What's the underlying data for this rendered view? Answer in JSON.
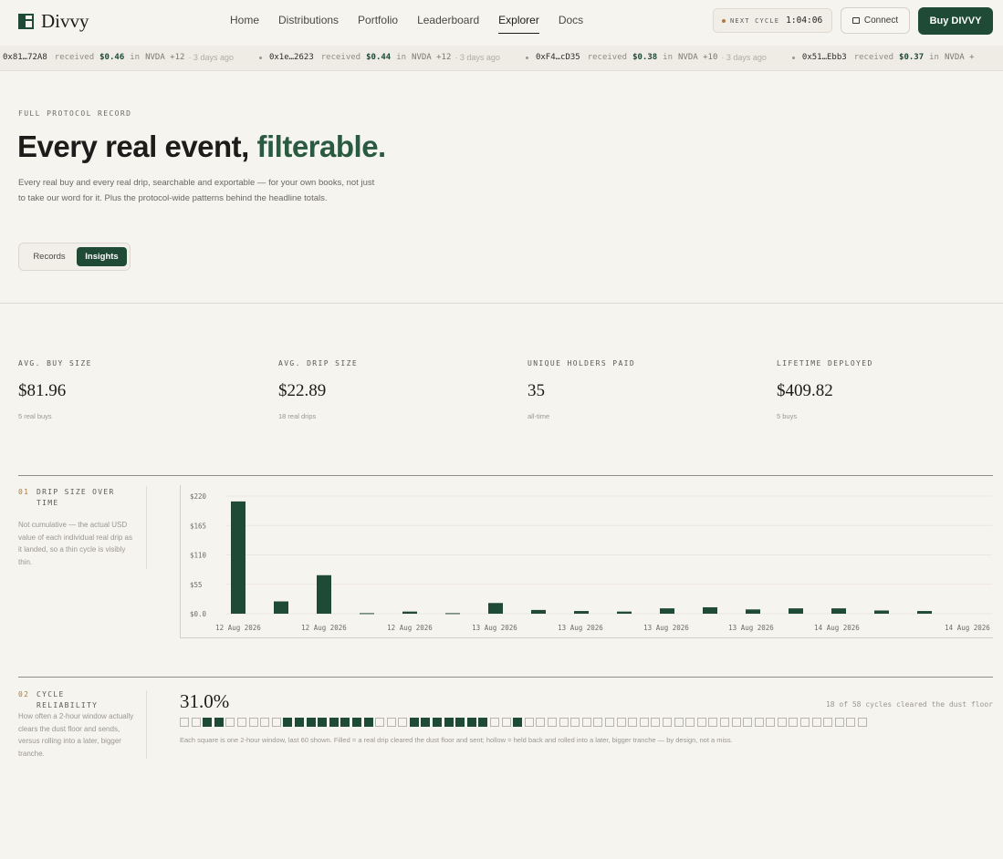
{
  "brand": {
    "name": "Divvy"
  },
  "nav": [
    {
      "label": "Home",
      "active": false
    },
    {
      "label": "Distributions",
      "active": false
    },
    {
      "label": "Portfolio",
      "active": false
    },
    {
      "label": "Leaderboard",
      "active": false
    },
    {
      "label": "Explorer",
      "active": true
    },
    {
      "label": "Docs",
      "active": false
    }
  ],
  "cycle": {
    "label": "NEXT CYCLE",
    "time": "1:04:06"
  },
  "header": {
    "connect_label": "Connect",
    "buy_label": "Buy DIVVY"
  },
  "ticker": [
    {
      "addr": "0x81…72A8",
      "verb": "received",
      "amount": "$0.46",
      "in": "in",
      "asset": "NVDA +12",
      "ago": "· 3 days ago"
    },
    {
      "addr": "0x1e…2623",
      "verb": "received",
      "amount": "$0.44",
      "in": "in",
      "asset": "NVDA +12",
      "ago": "· 3 days ago"
    },
    {
      "addr": "0xF4…cD35",
      "verb": "received",
      "amount": "$0.38",
      "in": "in",
      "asset": "NVDA +10",
      "ago": "· 3 days ago"
    },
    {
      "addr": "0x51…Ebb3",
      "verb": "received",
      "amount": "$0.37",
      "in": "in",
      "asset": "NVDA +",
      "ago": ""
    }
  ],
  "hero": {
    "eyebrow": "FULL PROTOCOL RECORD",
    "title_main": "Every real event, ",
    "title_accent": "filterable.",
    "description": "Every real buy and every real drip, searchable and exportable — for your own books, not just to take our word for it. Plus the protocol-wide patterns behind the headline totals."
  },
  "tabs": {
    "records": "Records",
    "insights": "Insights",
    "active": "Insights"
  },
  "stats": [
    {
      "label": "AVG. BUY SIZE",
      "value": "$81.96",
      "sub": "5 real buys"
    },
    {
      "label": "AVG. DRIP SIZE",
      "value": "$22.89",
      "sub": "18 real drips"
    },
    {
      "label": "UNIQUE HOLDERS PAID",
      "value": "35",
      "sub": "all-time"
    },
    {
      "label": "LIFETIME DEPLOYED",
      "value": "$409.82",
      "sub": "5 buys"
    }
  ],
  "drip_section": {
    "num": "01",
    "title": "DRIP SIZE OVER TIME",
    "desc": "Not cumulative — the actual USD value of each individual real drip as it landed, so a thin cycle is visibly thin."
  },
  "chart_data": {
    "type": "bar",
    "title": "",
    "xlabel": "",
    "ylabel": "",
    "ylim": [
      0,
      220
    ],
    "yticks": [
      "$220",
      "$165",
      "$110",
      "$55",
      "$0.0"
    ],
    "xticks": [
      "12 Aug 2026",
      "12 Aug 2026",
      "12 Aug 2026",
      "13 Aug 2026",
      "13 Aug 2026",
      "13 Aug 2026",
      "13 Aug 2026",
      "14 Aug 2026",
      "14 Aug 2026"
    ],
    "values": [
      210,
      23,
      72,
      1,
      4,
      1,
      20,
      7,
      5,
      4,
      10,
      12,
      8,
      10,
      10,
      6,
      5
    ],
    "grid": true,
    "color": "#1f4a36"
  },
  "reliability_section": {
    "num": "02",
    "title": "CYCLE RELIABILITY",
    "desc": "How often a 2-hour window actually clears the dust floor and sends, versus rolling into a later, bigger tranche.",
    "percent": "31.0%",
    "cleared": "18 of 58 cycles cleared the dust floor",
    "note": "Each square is one 2-hour window, last 60 shown. Filled = a real drip cleared the dust floor and sent; hollow = held back and rolled into a later, bigger tranche — by design, not a miss.",
    "squares": [
      0,
      0,
      1,
      1,
      0,
      0,
      0,
      0,
      0,
      1,
      1,
      1,
      1,
      1,
      1,
      1,
      1,
      0,
      0,
      0,
      1,
      1,
      1,
      1,
      1,
      1,
      1,
      0,
      0,
      1,
      0,
      0,
      0,
      0,
      0,
      0,
      0,
      0,
      0,
      0,
      0,
      0,
      0,
      0,
      0,
      0,
      0,
      0,
      0,
      0,
      0,
      0,
      0,
      0,
      0,
      0,
      0,
      0,
      0,
      0
    ]
  }
}
